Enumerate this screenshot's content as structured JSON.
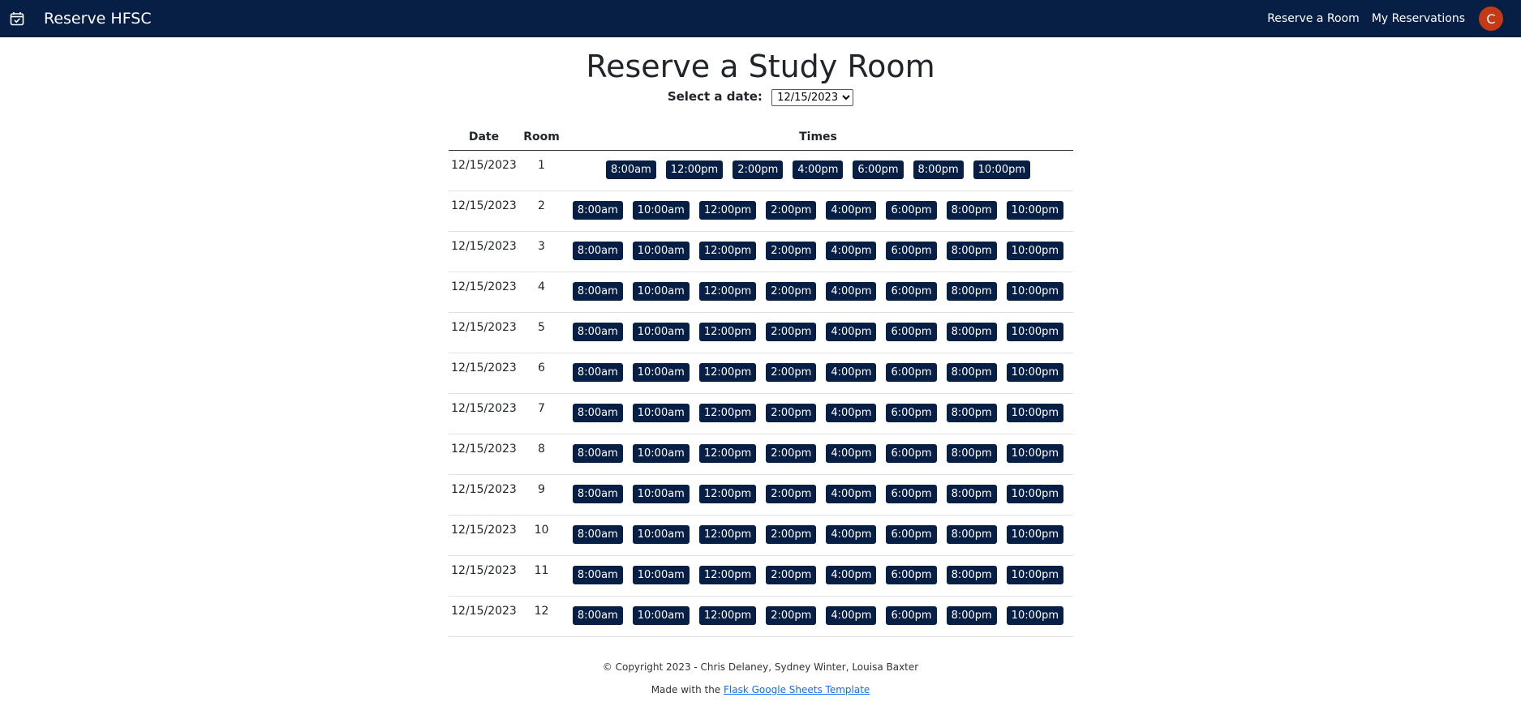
{
  "navbar": {
    "brand": "Reserve HFSC",
    "links": [
      "Reserve a Room",
      "My Reservations"
    ],
    "avatar_letter": "C",
    "avatar_color": "#c33a14",
    "bg_color": "#071e45"
  },
  "main": {
    "title": "Reserve a Study Room",
    "date_label": "Select a date:",
    "date_value": "12/15/2023"
  },
  "table": {
    "headers": [
      "Date",
      "Room",
      "Times"
    ],
    "rows": [
      {
        "date": "12/15/2023",
        "room": "1",
        "times": [
          "8:00am",
          "12:00pm",
          "2:00pm",
          "4:00pm",
          "6:00pm",
          "8:00pm",
          "10:00pm"
        ]
      },
      {
        "date": "12/15/2023",
        "room": "2",
        "times": [
          "8:00am",
          "10:00am",
          "12:00pm",
          "2:00pm",
          "4:00pm",
          "6:00pm",
          "8:00pm",
          "10:00pm"
        ]
      },
      {
        "date": "12/15/2023",
        "room": "3",
        "times": [
          "8:00am",
          "10:00am",
          "12:00pm",
          "2:00pm",
          "4:00pm",
          "6:00pm",
          "8:00pm",
          "10:00pm"
        ]
      },
      {
        "date": "12/15/2023",
        "room": "4",
        "times": [
          "8:00am",
          "10:00am",
          "12:00pm",
          "2:00pm",
          "4:00pm",
          "6:00pm",
          "8:00pm",
          "10:00pm"
        ]
      },
      {
        "date": "12/15/2023",
        "room": "5",
        "times": [
          "8:00am",
          "10:00am",
          "12:00pm",
          "2:00pm",
          "4:00pm",
          "6:00pm",
          "8:00pm",
          "10:00pm"
        ]
      },
      {
        "date": "12/15/2023",
        "room": "6",
        "times": [
          "8:00am",
          "10:00am",
          "12:00pm",
          "2:00pm",
          "4:00pm",
          "6:00pm",
          "8:00pm",
          "10:00pm"
        ]
      },
      {
        "date": "12/15/2023",
        "room": "7",
        "times": [
          "8:00am",
          "10:00am",
          "12:00pm",
          "2:00pm",
          "4:00pm",
          "6:00pm",
          "8:00pm",
          "10:00pm"
        ]
      },
      {
        "date": "12/15/2023",
        "room": "8",
        "times": [
          "8:00am",
          "10:00am",
          "12:00pm",
          "2:00pm",
          "4:00pm",
          "6:00pm",
          "8:00pm",
          "10:00pm"
        ]
      },
      {
        "date": "12/15/2023",
        "room": "9",
        "times": [
          "8:00am",
          "10:00am",
          "12:00pm",
          "2:00pm",
          "4:00pm",
          "6:00pm",
          "8:00pm",
          "10:00pm"
        ]
      },
      {
        "date": "12/15/2023",
        "room": "10",
        "times": [
          "8:00am",
          "10:00am",
          "12:00pm",
          "2:00pm",
          "4:00pm",
          "6:00pm",
          "8:00pm",
          "10:00pm"
        ]
      },
      {
        "date": "12/15/2023",
        "room": "11",
        "times": [
          "8:00am",
          "10:00am",
          "12:00pm",
          "2:00pm",
          "4:00pm",
          "6:00pm",
          "8:00pm",
          "10:00pm"
        ]
      },
      {
        "date": "12/15/2023",
        "room": "12",
        "times": [
          "8:00am",
          "10:00am",
          "12:00pm",
          "2:00pm",
          "4:00pm",
          "6:00pm",
          "8:00pm",
          "10:00pm"
        ]
      }
    ]
  },
  "footer": {
    "copyright": "© Copyright 2023 - Chris Delaney, Sydney Winter, Louisa Baxter",
    "made_with": "Made with the",
    "link_text": "Flask Google Sheets Template"
  }
}
